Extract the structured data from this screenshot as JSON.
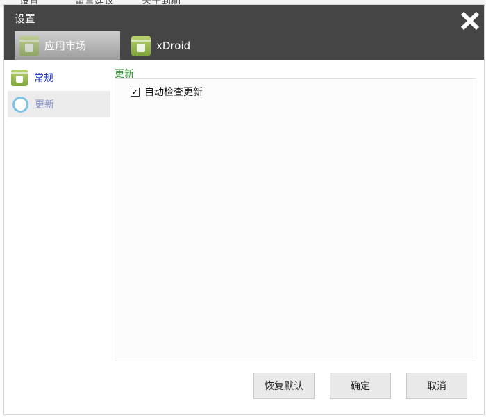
{
  "background_app": {
    "partial_labels": [
      "设置",
      "留言建议",
      "关于到期"
    ]
  },
  "dialog": {
    "title": "设置",
    "close_icon": "close-icon",
    "tabs": [
      {
        "label": "应用市场",
        "icon": "android-market-icon",
        "selected": true
      },
      {
        "label": "xDroid",
        "icon": "android-market-icon",
        "selected": false
      }
    ],
    "sidebar": [
      {
        "label": "常规",
        "icon": "android-market-icon",
        "selected": false
      },
      {
        "label": "更新",
        "icon": "update-ring-icon",
        "selected": true
      }
    ],
    "section_title": "更新",
    "options": [
      {
        "label": "自动检查更新",
        "checked": true
      }
    ],
    "buttons": {
      "restore_defaults": "恢复默认",
      "ok": "确定",
      "cancel": "取消"
    },
    "colors": {
      "header_bg": "#454545",
      "section_title": "#2c8f2c",
      "sidebar_link": "#1a2fc4",
      "sidebar_selected_text": "#8a94c9"
    }
  }
}
